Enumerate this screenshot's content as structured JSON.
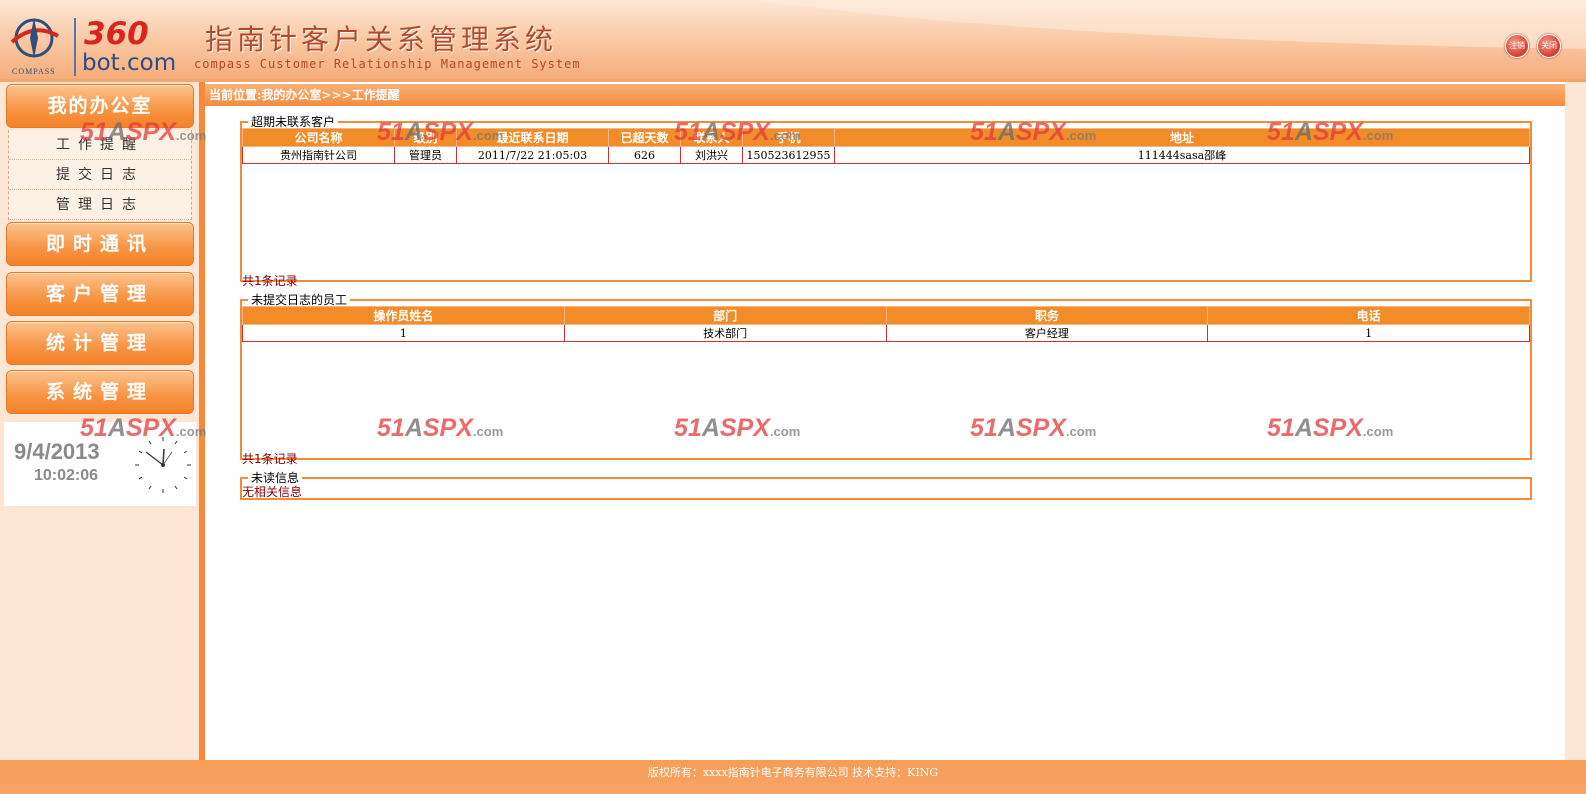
{
  "header": {
    "logo_compass": "COMPASS",
    "logo_360": "360",
    "logo_bot": "bot.com",
    "title": "指南针客户关系管理系统",
    "subtitle": "compass Customer Relationship Management System",
    "logout_label": "注销",
    "close_label": "关闭"
  },
  "sidebar": {
    "menus": [
      {
        "label": "我的办公室"
      },
      {
        "label": "即时通讯"
      },
      {
        "label": "客户管理"
      },
      {
        "label": "统计管理"
      },
      {
        "label": "系统管理"
      }
    ],
    "submenu": [
      {
        "label": "工作提醒"
      },
      {
        "label": "提交日志"
      },
      {
        "label": "管理日志"
      }
    ],
    "clock": {
      "date": "9/4/2013",
      "time": "10:02:06"
    }
  },
  "breadcrumb": "当前位置:我的办公室>>>工作提醒",
  "overdue": {
    "legend": "超期未联系客户",
    "columns": [
      "公司名称",
      "级别",
      "最近联系日期",
      "已超天数",
      "联系人",
      "手机",
      "地址"
    ],
    "rows": [
      [
        "贵州指南针公司",
        "管理员",
        "2011/7/22 21:05:03",
        "626",
        "刘洪兴",
        "150523612955",
        "111444sasa邵峰"
      ]
    ],
    "count": "共1条记录"
  },
  "no_log": {
    "legend": "未提交日志的员工",
    "columns": [
      "操作员姓名",
      "部门",
      "职务",
      "电话"
    ],
    "rows": [
      [
        "1",
        "技术部门",
        "客户经理",
        "1"
      ]
    ],
    "count": "共1条记录"
  },
  "unread": {
    "legend": "未读信息",
    "text": "无相关信息"
  },
  "watermark": {
    "num": "51",
    "a": "A",
    "spx": "SPX",
    "dotcom": ".com"
  },
  "footer": "版权所有：xxxx指南针电子商务有限公司  技术支持：KING",
  "colors": {
    "accent": "#f28c28",
    "header": "#f9c6a0",
    "border": "#f48a3a"
  }
}
